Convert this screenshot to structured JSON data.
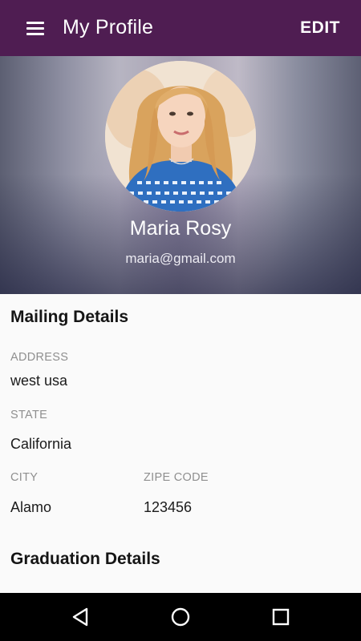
{
  "appbar": {
    "title": "My Profile",
    "edit_label": "EDIT"
  },
  "profile": {
    "name": "Maria Rosy",
    "email": "maria@gmail.com"
  },
  "mailing": {
    "section_title": "Mailing Details",
    "address_label": "ADDRESS",
    "address_value": "west usa",
    "state_label": "STATE",
    "state_value": "California",
    "city_label": "CITY",
    "city_value": "Alamo",
    "zip_label": "ZIPE CODE",
    "zip_value": "123456"
  },
  "graduation": {
    "section_title": "Graduation Details"
  },
  "icons": {
    "menu": "menu-icon",
    "back": "back-icon",
    "home": "home-icon",
    "recents": "recents-icon"
  },
  "colors": {
    "appbar": "#4f1d52",
    "navbar": "#000000",
    "background": "#fafafa"
  }
}
